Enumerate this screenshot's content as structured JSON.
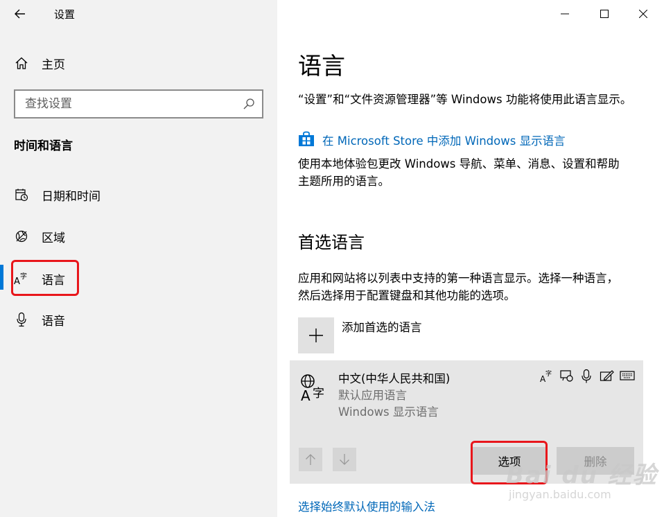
{
  "window": {
    "title": "设置"
  },
  "sidebar": {
    "home_label": "主页",
    "search_placeholder": "查找设置",
    "section_title": "时间和语言",
    "items": [
      {
        "label": "日期和时间",
        "icon": "calendar-clock-icon"
      },
      {
        "label": "区域",
        "icon": "globe-region-icon"
      },
      {
        "label": "语言",
        "icon": "language-icon",
        "selected": true
      },
      {
        "label": "语音",
        "icon": "microphone-icon"
      }
    ]
  },
  "main": {
    "page_title": "语言",
    "display_desc": "“设置”和“文件资源管理器”等 Windows 功能将使用此语言显示。",
    "store_link": "在 Microsoft Store 中添加 Windows 显示语言",
    "pack_desc_line1": "使用本地体验包更改 Windows 导航、菜单、消息、设置和帮助",
    "pack_desc_line2": "主题所用的语言。",
    "preferred_title": "首选语言",
    "preferred_desc_line1": "应用和网站将以列表中支持的第一种语言显示。选择一种语言，",
    "preferred_desc_line2": "然后选择用于配置键盘和其他功能的选项。",
    "add_language_label": "添加首选的语言",
    "language_card": {
      "name": "中文(中华人民共和国)",
      "sub1": "默认应用语言",
      "sub2": "Windows 显示语言",
      "options_label": "选项",
      "remove_label": "删除",
      "feature_icons": [
        "language-pack-icon",
        "speech-recognition-icon",
        "microphone-icon",
        "handwriting-icon",
        "keyboard-icon"
      ]
    },
    "input_method_link": "选择始终默认使用的输入法"
  },
  "watermark": {
    "brand": "Bai du 经验",
    "url": "jingyan.baidu.com"
  },
  "colors": {
    "accent": "#0078d7",
    "link": "#0067b8",
    "highlight_box": "#e8161b",
    "sidebar_bg": "#f2f2f2"
  }
}
